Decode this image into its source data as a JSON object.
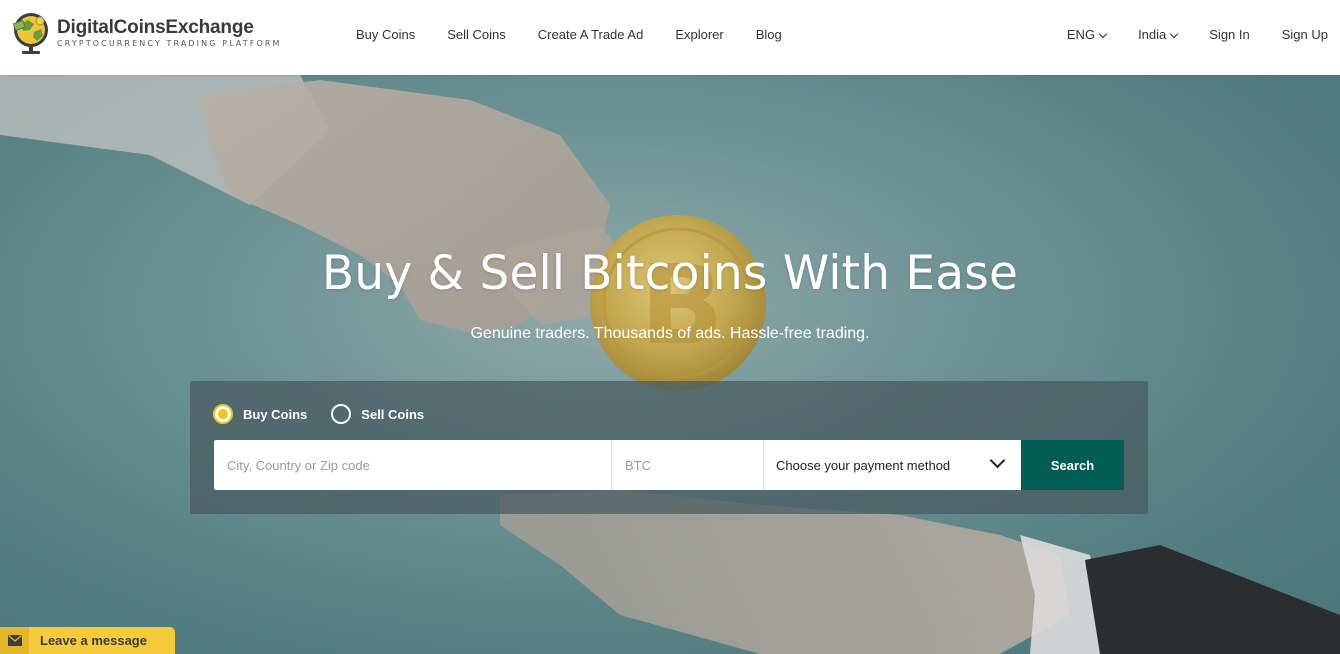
{
  "brand": {
    "name": "DigitalCoinsExchange",
    "tagline": "CRYPTOCURRENCY TRADING PLATFORM"
  },
  "nav": {
    "items": [
      {
        "label": "Buy Coins"
      },
      {
        "label": "Sell Coins"
      },
      {
        "label": "Create A Trade Ad"
      },
      {
        "label": "Explorer"
      },
      {
        "label": "Blog"
      }
    ],
    "language": "ENG",
    "country": "India",
    "sign_in": "Sign In",
    "sign_up": "Sign Up"
  },
  "hero": {
    "title": "Buy & Sell Bitcoins With Ease",
    "subtitle": "Genuine traders. Thousands of ads. Hassle-free trading."
  },
  "search": {
    "mode_options": [
      {
        "label": "Buy Coins",
        "selected": true
      },
      {
        "label": "Sell Coins",
        "selected": false
      }
    ],
    "location_placeholder": "City, Country or Zip code",
    "currency_placeholder": "BTC",
    "payment_method": "Choose your payment method",
    "button_label": "Search"
  },
  "chat": {
    "label": "Leave a message"
  },
  "colors": {
    "accent_yellow": "#f2c318",
    "search_button": "#025e55",
    "chat_background": "#f5cb3a"
  }
}
